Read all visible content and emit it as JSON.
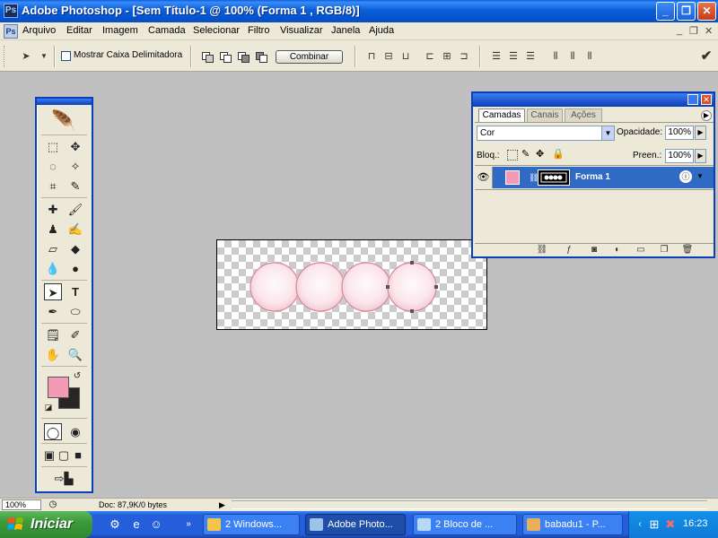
{
  "window": {
    "title": "Adobe Photoshop - [Sem Título-1 @ 100% (Forma 1 , RGB/8)]",
    "app_icon_letters": "Ps"
  },
  "menu": {
    "items": [
      "Arquivo",
      "Editar",
      "Imagem",
      "Camada",
      "Selecionar",
      "Filtro",
      "Visualizar",
      "Janela",
      "Ajuda"
    ]
  },
  "options": {
    "bounding_box_label": "Mostrar Caixa Delimitadora",
    "combine_label": "Combinar"
  },
  "toolbox": {
    "fg_color": "#f49ab6",
    "bg_color": "#2a2525"
  },
  "canvas": {
    "shape_fill": "#fdf0f3",
    "shape_stroke": "#d8879a",
    "circle_count": 4
  },
  "layers_panel": {
    "tabs": [
      "Camadas",
      "Canais",
      "Ações"
    ],
    "blend_mode": "Cor",
    "opacity_label": "Opacidade:",
    "opacity_value": "100%",
    "lock_label": "Bloq.:",
    "fill_label": "Preen.:",
    "fill_value": "100%",
    "layer_name": "Forma 1",
    "layer_color": "#f49ab6"
  },
  "status": {
    "zoom": "100%",
    "doc_info": "Doc: 87,9K/0 bytes"
  },
  "taskbar": {
    "start_label": "Iniciar",
    "buttons": [
      "2 Windows...",
      "Adobe Photo...",
      "2 Bloco de ...",
      "babadu1 - P..."
    ],
    "clock": "16:23"
  }
}
